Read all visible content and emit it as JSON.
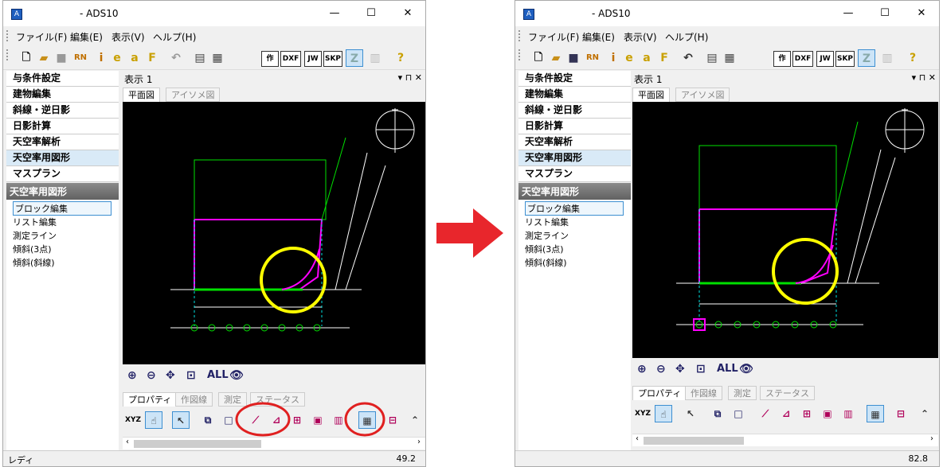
{
  "window_title": "- ADS10",
  "window_buttons": {
    "minimize": "—",
    "maximize": "☐",
    "close": "✕"
  },
  "menu": [
    "ファイル(F)",
    "編集(E)",
    "表示(V)",
    "ヘルプ(H)"
  ],
  "toolbar": [
    "作",
    "DXF",
    "JW",
    "SKP",
    "Z",
    "?"
  ],
  "left_buttons": [
    "与条件設定",
    "建物編集",
    "斜線・逆日影",
    "日影計算",
    "天空率解析",
    "天空率用図形",
    "マスプラン"
  ],
  "section_title": "天空率用図形",
  "section_items": [
    "ブロック編集",
    "リスト編集",
    "測定ライン",
    "傾斜(3点)",
    "傾斜(斜線)"
  ],
  "view_title": "表示 1",
  "view_tabs": [
    "平面図",
    "アイソメ図"
  ],
  "view_controls": "▾ ⊓ ✕",
  "zoom_all": "ALL",
  "prop_tabs": [
    "プロパティ",
    "作図線",
    "測定",
    "ステータス"
  ],
  "xyz": "XYZ",
  "status_left": "レディ",
  "status_right_before": "49.2",
  "status_right_after": "82.8",
  "colors": {
    "accent": "#3d8fd1",
    "highlight_circle": "#ffff00",
    "annotation_red": "#e02020",
    "arrow": "#e8262c"
  }
}
